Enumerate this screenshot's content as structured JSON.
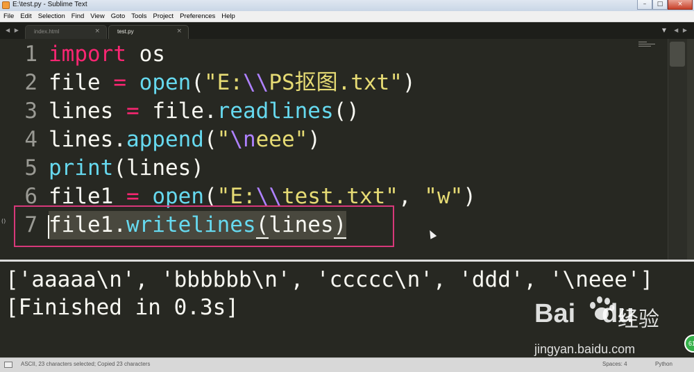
{
  "window": {
    "title": "E:\\test.py - Sublime Text",
    "controls": [
      "–",
      "□",
      "×"
    ]
  },
  "menu": [
    "File",
    "Edit",
    "Selection",
    "Find",
    "View",
    "Goto",
    "Tools",
    "Project",
    "Preferences",
    "Help"
  ],
  "tabs": [
    {
      "label": "index.html",
      "active": false,
      "close": "×"
    },
    {
      "label": "test.py",
      "active": true,
      "close": "×"
    }
  ],
  "tab_nav_left": "◀ ▶",
  "tab_nav_right": "◀ ▶",
  "tab_menu": "▼",
  "editor": {
    "line_numbers": [
      "1",
      "2",
      "3",
      "4",
      "5",
      "6",
      "7"
    ],
    "gutter_marker": "()",
    "lines": [
      "import os",
      "file = open(\"E:\\\\PS抠图.txt\")",
      "lines = file.readlines()",
      "lines.append(\"\\neee\")",
      "print(lines)",
      "file1 = open(\"E:\\\\test.txt\", \"w\")",
      "file1.writelines(lines)"
    ],
    "current_line": 7,
    "selected_line": 7
  },
  "console": {
    "lines": [
      "['aaaaa\\n', 'bbbbbb\\n', 'ccccc\\n', 'ddd', '\\neee']",
      "[Finished in 0.3s]"
    ]
  },
  "watermark": {
    "logo": "Bai",
    "logo_suffix": "du",
    "chinese": "经验",
    "url": "jingyan.baidu.com",
    "badge": "61"
  },
  "statusbar": {
    "message": "ASCII, 23 characters selected; Copied 23 characters",
    "spaces": "Spaces: 4",
    "syntax": "Python"
  },
  "colors": {
    "background": "#272822",
    "keyword": "#f92672",
    "function": "#66d9ef",
    "string": "#e6db74",
    "escape": "#ae81ff",
    "annotation_box": "#d8387a"
  }
}
